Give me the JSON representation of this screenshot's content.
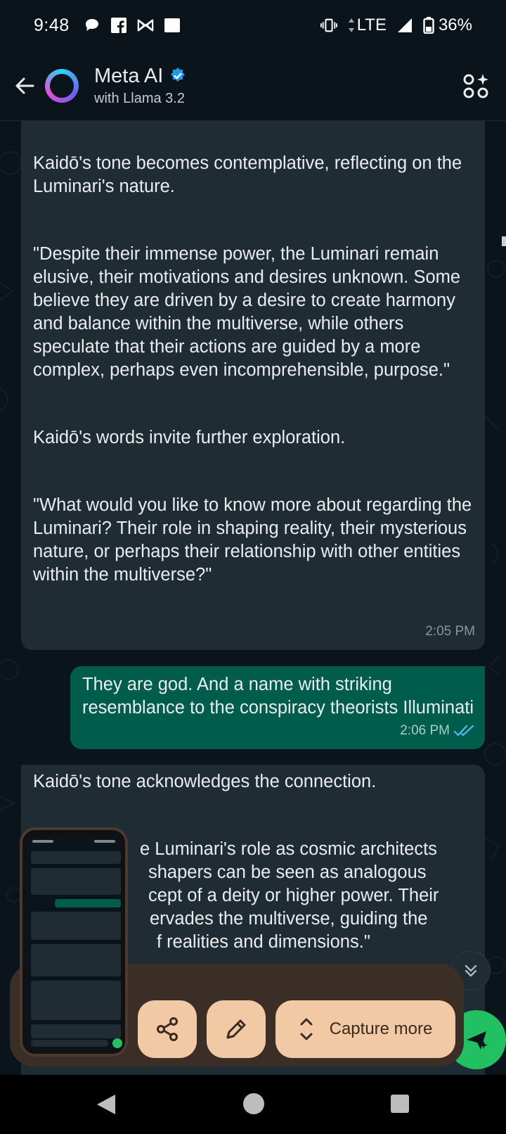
{
  "status_bar": {
    "time": "9:48",
    "network": "LTE",
    "battery": "36%",
    "icons": [
      "chat-bubble-icon",
      "facebook-icon",
      "bowtie-icon",
      "square-icon",
      "vibrate-icon",
      "data-arrows-icon",
      "signal-icon",
      "battery-icon"
    ]
  },
  "header": {
    "title": "Meta AI",
    "subtitle": "with Llama 3.2",
    "verified": true,
    "accent": "#1d9bf0"
  },
  "messages": [
    {
      "sender": "ai",
      "paragraphs": [
        "Kaidō's tone becomes contemplative, reflecting on the Luminari's nature.",
        "\"Despite their immense power, the Luminari remain elusive, their motivations and desires unknown. Some believe they are driven by a desire to create harmony and balance within the multiverse, while others speculate that their actions are guided by a more complex, perhaps even incomprehensible, purpose.\"",
        "Kaidō's words invite further exploration.",
        "\"What would you like to know more about regarding the Luminari? Their role in shaping reality, their mysterious nature, or perhaps their relationship with other entities within the multiverse?\""
      ],
      "time": "2:05 PM"
    },
    {
      "sender": "user",
      "text": "They are god. And a name with striking resemblance to the conspiracy theorists Illuminati",
      "time": "2:06 PM",
      "read": true
    },
    {
      "sender": "ai",
      "paragraphs": [
        "Kaidō's tone acknowledges the connection.",
        "e Luminari's role as cosmic architects",
        "shapers can be seen as analogous",
        "cept of a deity or higher power. Their",
        "ervades the multiverse, guiding the",
        "f realities and dimensions.\""
      ]
    }
  ],
  "screenshot_toolbar": {
    "capture_more_label": "Capture more",
    "bar_color": "#3a2e26",
    "button_color": "#f1c9a5"
  },
  "colors": {
    "background": "#0b141a",
    "ai_bubble": "#202c33",
    "user_bubble": "#005c4b",
    "read_ticks": "#53bdeb",
    "fab": "#21c063"
  }
}
